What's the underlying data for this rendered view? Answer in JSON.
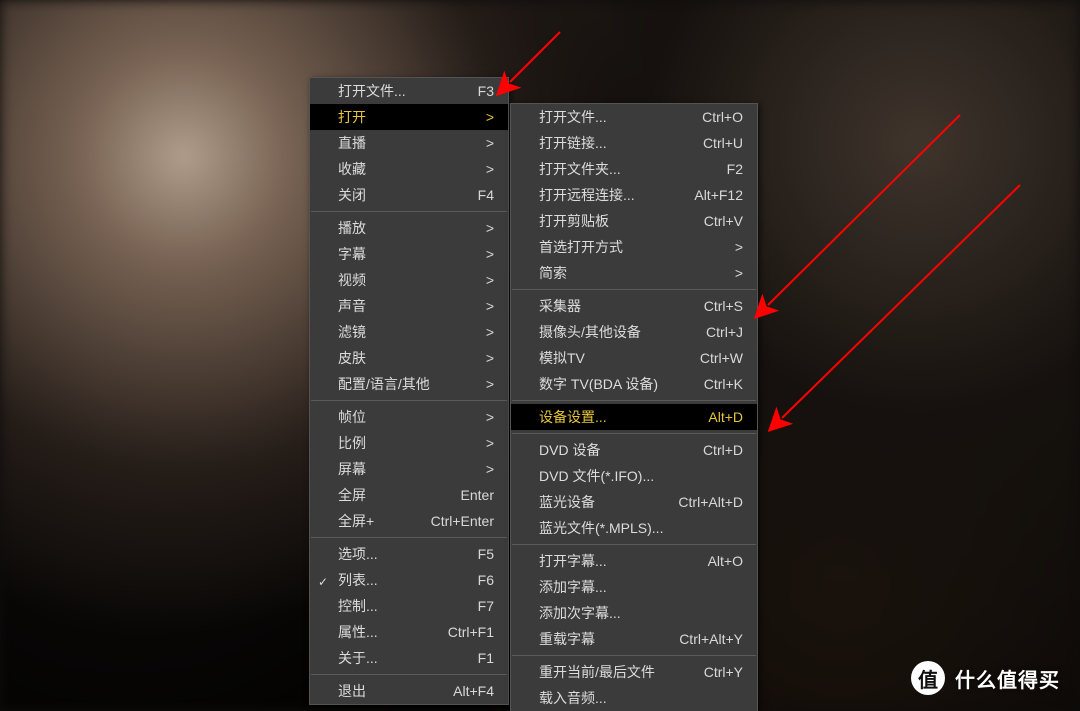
{
  "menu1": {
    "items": [
      {
        "label": "打开文件...",
        "accel": "F3",
        "sub": false,
        "checked": false,
        "hl": false,
        "sep": false
      },
      {
        "label": "打开",
        "accel": "",
        "sub": true,
        "checked": false,
        "hl": true,
        "sep": false
      },
      {
        "label": "直播",
        "accel": "",
        "sub": true,
        "checked": false,
        "hl": false,
        "sep": false
      },
      {
        "label": "收藏",
        "accel": "",
        "sub": true,
        "checked": false,
        "hl": false,
        "sep": false
      },
      {
        "label": "关闭",
        "accel": "F4",
        "sub": false,
        "checked": false,
        "hl": false,
        "sep": false
      },
      {
        "sep": true
      },
      {
        "label": "播放",
        "accel": "",
        "sub": true,
        "checked": false,
        "hl": false,
        "sep": false
      },
      {
        "label": "字幕",
        "accel": "",
        "sub": true,
        "checked": false,
        "hl": false,
        "sep": false
      },
      {
        "label": "视频",
        "accel": "",
        "sub": true,
        "checked": false,
        "hl": false,
        "sep": false
      },
      {
        "label": "声音",
        "accel": "",
        "sub": true,
        "checked": false,
        "hl": false,
        "sep": false
      },
      {
        "label": "滤镜",
        "accel": "",
        "sub": true,
        "checked": false,
        "hl": false,
        "sep": false
      },
      {
        "label": "皮肤",
        "accel": "",
        "sub": true,
        "checked": false,
        "hl": false,
        "sep": false
      },
      {
        "label": "配置/语言/其他",
        "accel": "",
        "sub": true,
        "checked": false,
        "hl": false,
        "sep": false
      },
      {
        "sep": true
      },
      {
        "label": "帧位",
        "accel": "",
        "sub": true,
        "checked": false,
        "hl": false,
        "sep": false
      },
      {
        "label": "比例",
        "accel": "",
        "sub": true,
        "checked": false,
        "hl": false,
        "sep": false
      },
      {
        "label": "屏幕",
        "accel": "",
        "sub": true,
        "checked": false,
        "hl": false,
        "sep": false
      },
      {
        "label": "全屏",
        "accel": "Enter",
        "sub": false,
        "checked": false,
        "hl": false,
        "sep": false
      },
      {
        "label": "全屏+",
        "accel": "Ctrl+Enter",
        "sub": false,
        "checked": false,
        "hl": false,
        "sep": false
      },
      {
        "sep": true
      },
      {
        "label": "选项...",
        "accel": "F5",
        "sub": false,
        "checked": false,
        "hl": false,
        "sep": false
      },
      {
        "label": "列表...",
        "accel": "F6",
        "sub": false,
        "checked": true,
        "hl": false,
        "sep": false
      },
      {
        "label": "控制...",
        "accel": "F7",
        "sub": false,
        "checked": false,
        "hl": false,
        "sep": false
      },
      {
        "label": "属性...",
        "accel": "Ctrl+F1",
        "sub": false,
        "checked": false,
        "hl": false,
        "sep": false
      },
      {
        "label": "关于...",
        "accel": "F1",
        "sub": false,
        "checked": false,
        "hl": false,
        "sep": false
      },
      {
        "sep": true
      },
      {
        "label": "退出",
        "accel": "Alt+F4",
        "sub": false,
        "checked": false,
        "hl": false,
        "sep": false
      }
    ]
  },
  "menu2": {
    "items": [
      {
        "label": "打开文件...",
        "accel": "Ctrl+O",
        "sub": false,
        "hl": false,
        "sep": false
      },
      {
        "label": "打开链接...",
        "accel": "Ctrl+U",
        "sub": false,
        "hl": false,
        "sep": false
      },
      {
        "label": "打开文件夹...",
        "accel": "F2",
        "sub": false,
        "hl": false,
        "sep": false
      },
      {
        "label": "打开远程连接...",
        "accel": "Alt+F12",
        "sub": false,
        "hl": false,
        "sep": false
      },
      {
        "label": "打开剪贴板",
        "accel": "Ctrl+V",
        "sub": false,
        "hl": false,
        "sep": false
      },
      {
        "label": "首选打开方式",
        "accel": "",
        "sub": true,
        "hl": false,
        "sep": false
      },
      {
        "label": "简索",
        "accel": "",
        "sub": true,
        "hl": false,
        "sep": false
      },
      {
        "sep": true
      },
      {
        "label": "采集器",
        "accel": "Ctrl+S",
        "sub": false,
        "hl": false,
        "sep": false
      },
      {
        "label": "摄像头/其他设备",
        "accel": "Ctrl+J",
        "sub": false,
        "hl": false,
        "sep": false
      },
      {
        "label": "模拟TV",
        "accel": "Ctrl+W",
        "sub": false,
        "hl": false,
        "sep": false
      },
      {
        "label": "数字 TV(BDA 设备)",
        "accel": "Ctrl+K",
        "sub": false,
        "hl": false,
        "sep": false
      },
      {
        "sep": true
      },
      {
        "label": "设备设置...",
        "accel": "Alt+D",
        "sub": false,
        "hl": true,
        "sep": false
      },
      {
        "sep": true
      },
      {
        "label": "DVD 设备",
        "accel": "Ctrl+D",
        "sub": false,
        "hl": false,
        "sep": false
      },
      {
        "label": "DVD 文件(*.IFO)...",
        "accel": "",
        "sub": false,
        "hl": false,
        "sep": false
      },
      {
        "label": "蓝光设备",
        "accel": "Ctrl+Alt+D",
        "sub": false,
        "hl": false,
        "sep": false
      },
      {
        "label": "蓝光文件(*.MPLS)...",
        "accel": "",
        "sub": false,
        "hl": false,
        "sep": false
      },
      {
        "sep": true
      },
      {
        "label": "打开字幕...",
        "accel": "Alt+O",
        "sub": false,
        "hl": false,
        "sep": false
      },
      {
        "label": "添加字幕...",
        "accel": "",
        "sub": false,
        "hl": false,
        "sep": false
      },
      {
        "label": "添加次字幕...",
        "accel": "",
        "sub": false,
        "hl": false,
        "sep": false
      },
      {
        "label": "重载字幕",
        "accel": "Ctrl+Alt+Y",
        "sub": false,
        "hl": false,
        "sep": false
      },
      {
        "sep": true
      },
      {
        "label": "重开当前/最后文件",
        "accel": "Ctrl+Y",
        "sub": false,
        "hl": false,
        "sep": false
      },
      {
        "label": "载入音频...",
        "accel": "",
        "sub": false,
        "hl": false,
        "sep": false
      }
    ]
  },
  "watermark": {
    "badge": "值",
    "text": "什么值得买"
  },
  "arrows": {
    "color": "#ff0000"
  }
}
